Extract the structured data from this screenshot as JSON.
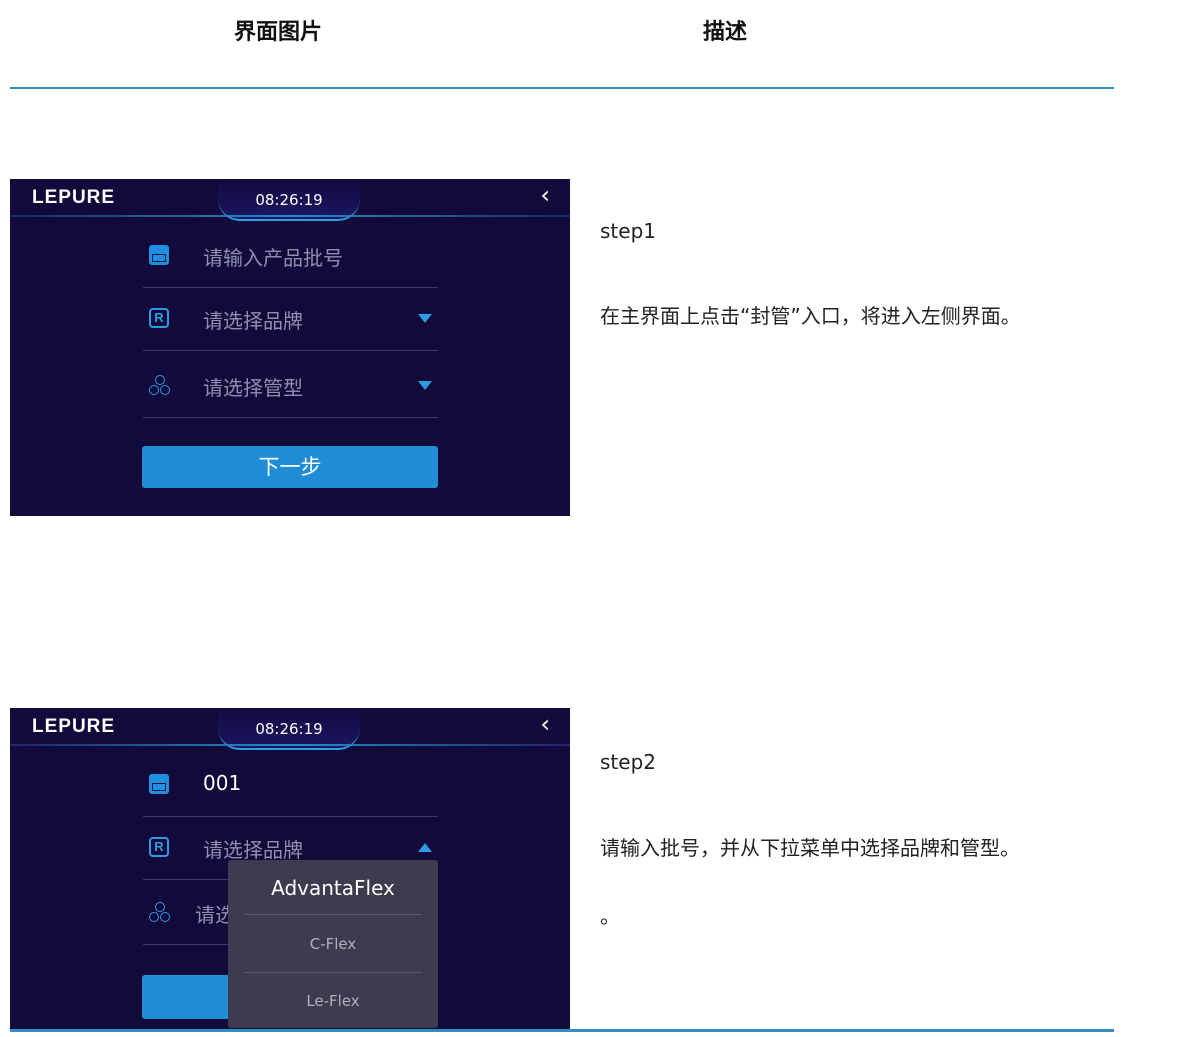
{
  "table_header": {
    "col1": "界面图片",
    "col2": "描述"
  },
  "app": {
    "logo": "LEPURE",
    "time": "08:26:19"
  },
  "screen1": {
    "batch_placeholder": "请输入产品批号",
    "brand_placeholder": "请选择品牌",
    "type_placeholder": "请选择管型",
    "next_label": "下一步"
  },
  "screen2": {
    "batch_value": "001",
    "brand_placeholder": "请选择品牌",
    "type_placeholder_partial": "请选",
    "dropdown_options": [
      "AdvantaFlex",
      "C-Flex",
      "Le-Flex"
    ]
  },
  "steps": [
    {
      "title": "step1",
      "text": "在主界面上点击“封管”入口，将进入左侧界面。"
    },
    {
      "title": "step2",
      "text": "请输入批号，并从下拉菜单中选择品牌和管型。",
      "extra": "。"
    }
  ],
  "colors": {
    "screen_bg": "#110a3a",
    "accent": "#1f8ed6",
    "rule": "#2f8fbd"
  },
  "icons": [
    "batch-icon",
    "brand-icon",
    "tube-type-icon",
    "back-chevron-icon",
    "caret-down-icon",
    "caret-up-icon"
  ]
}
